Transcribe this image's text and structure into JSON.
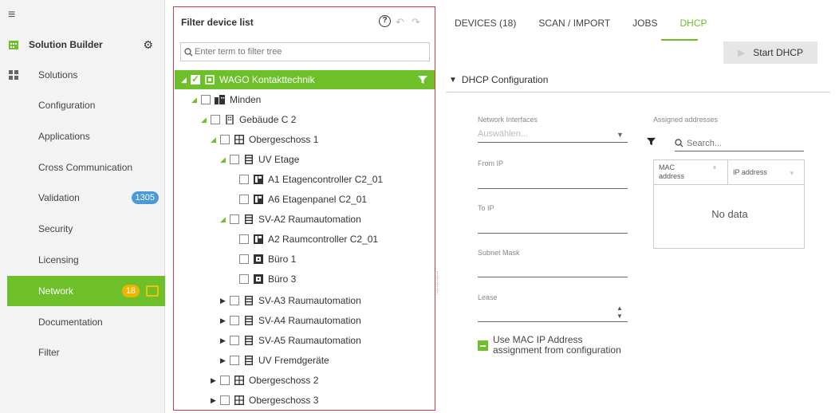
{
  "sidebar": {
    "app_title": "Solution Builder",
    "items": [
      {
        "label": "Solutions"
      },
      {
        "label": "Configuration"
      },
      {
        "label": "Applications"
      },
      {
        "label": "Cross Communication"
      },
      {
        "label": "Validation",
        "badge": "1305"
      },
      {
        "label": "Security"
      },
      {
        "label": "Licensing"
      },
      {
        "label": "Network",
        "badge": "18"
      },
      {
        "label": "Documentation"
      },
      {
        "label": "Filter"
      }
    ]
  },
  "tree_panel": {
    "title": "Filter device list",
    "search_placeholder": "Enter term to filter tree",
    "rows": [
      {
        "label": "WAGO Kontakttechnik"
      },
      {
        "label": "Minden"
      },
      {
        "label": "Gebäude C 2"
      },
      {
        "label": "Obergeschoss 1"
      },
      {
        "label": "UV Etage"
      },
      {
        "label": "A1 Etagencontroller C2_01"
      },
      {
        "label": "A6 Etagenpanel C2_01"
      },
      {
        "label": "SV-A2 Raumautomation"
      },
      {
        "label": "A2 Raumcontroller C2_01"
      },
      {
        "label": "Büro 1"
      },
      {
        "label": "Büro 3"
      },
      {
        "label": "SV-A3 Raumautomation"
      },
      {
        "label": "SV-A4 Raumautomation"
      },
      {
        "label": "SV-A5 Raumautomation"
      },
      {
        "label": "UV Fremdgeräte"
      },
      {
        "label": "Obergeschoss 2"
      },
      {
        "label": "Obergeschoss 3"
      }
    ]
  },
  "tabs": [
    {
      "label": "DEVICES (18)"
    },
    {
      "label": "SCAN / IMPORT"
    },
    {
      "label": "JOBS"
    },
    {
      "label": "DHCP",
      "active": true
    }
  ],
  "dhcp": {
    "start_button": "Start DHCP",
    "section_title": "DHCP Configuration",
    "network_interfaces_label": "Network Interfaces",
    "network_interfaces_placeholder": "Auswählen...",
    "from_ip_label": "From IP",
    "to_ip_label": "To IP",
    "subnet_mask_label": "Subnet Mask",
    "lease_label": "Lease",
    "use_mac_label_line1": "Use MAC IP Address",
    "use_mac_label_line2": "assignment from configuration",
    "assigned_label": "Assigned addresses",
    "assigned_search_placeholder": "Search...",
    "table_headers": {
      "mac_line1": "MAC",
      "mac_line2": "address",
      "ip": "IP address"
    },
    "no_data": "No data"
  },
  "colors": {
    "accent": "#6ec02a",
    "validation_badge": "#4a9ad9",
    "network_badge": "#f0b400",
    "highlight_border": "#d9363e"
  }
}
